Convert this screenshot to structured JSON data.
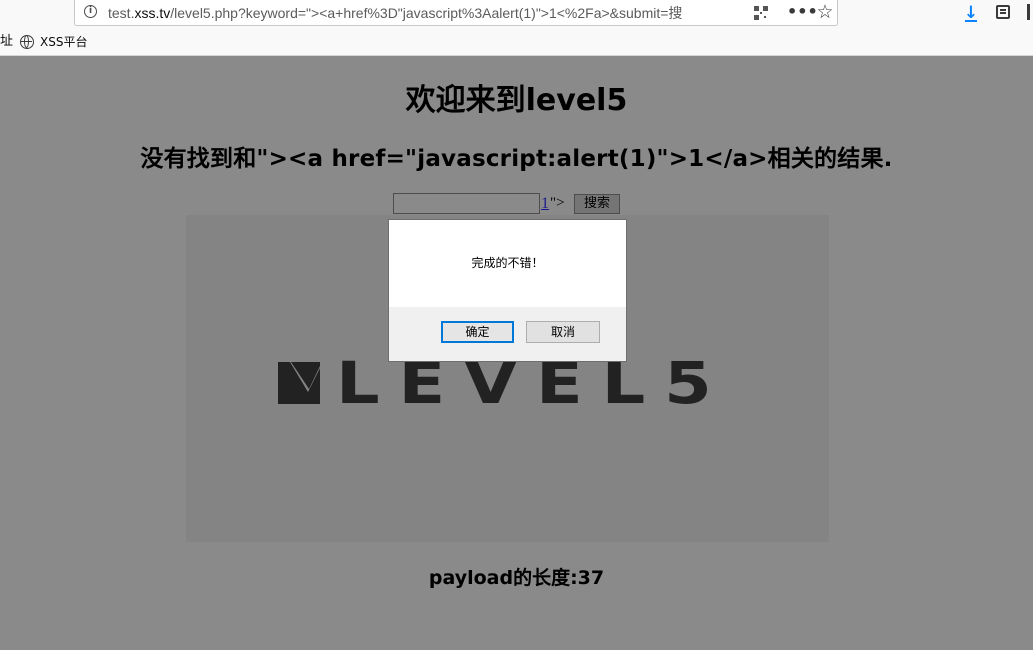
{
  "browser": {
    "url_prefix": "test.",
    "url_domain": "xss.tv",
    "url_path": "/level5.php?keyword=\"><a+href%3D\"javascript%3Aalert(1)\">1<%2Fa>&submit=搜",
    "bookmarks_cut_label": "址",
    "bookmark": {
      "label": "XSS平台",
      "icon": "globe-icon"
    },
    "icons": [
      "info-icon",
      "qr-code-icon",
      "more-icon",
      "star-icon",
      "download-icon",
      "library-icon"
    ],
    "accent_color": "#0a84ff"
  },
  "page": {
    "title": "欢迎来到level5",
    "result_text": "没有找到和\"><a href=\"javascript:alert(1)\">1</a>相关的结果.",
    "search_input_value": "",
    "injected_link_text": "1",
    "injected_tail_text": "\">",
    "search_button_label": "搜索",
    "banner_logo_text": "LEVEL5",
    "payload_length_text": "payload的长度:37",
    "background_color": "#8a8a8a"
  },
  "dialog": {
    "message": "完成的不错！",
    "ok_label": "确定",
    "cancel_label": "取消",
    "focus_color": "#0078d7"
  }
}
